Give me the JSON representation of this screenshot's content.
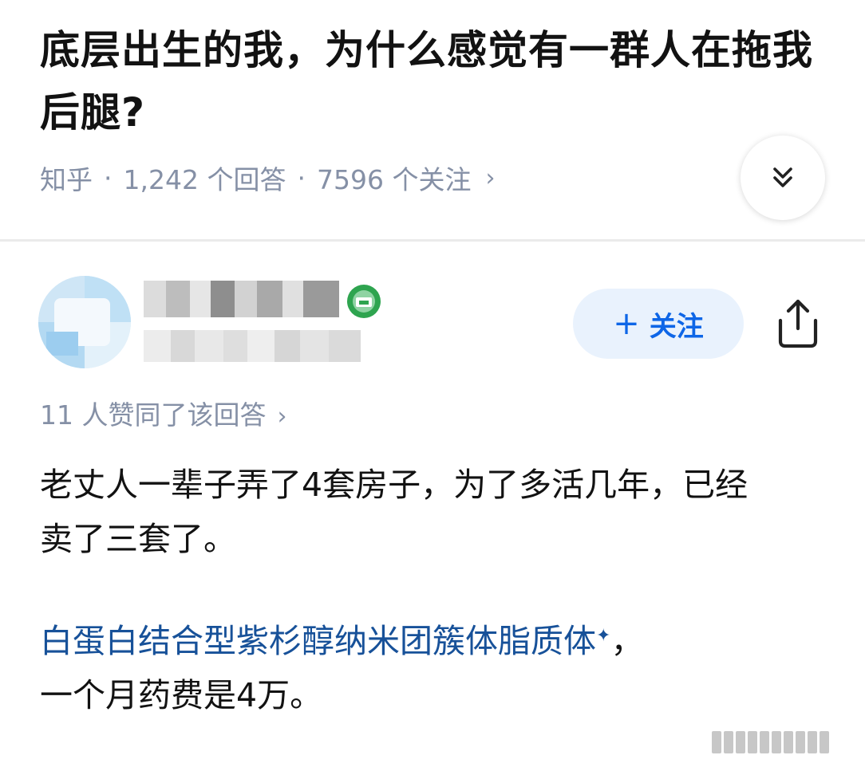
{
  "question": {
    "title": "底层出生的我，为什么感觉有一群人在拖我后腿?",
    "source": "知乎",
    "answers_count": "1,242 个回答",
    "followers_count": "7596 个关注"
  },
  "author": {
    "follow_label": "关注",
    "follow_plus": "+"
  },
  "answer": {
    "likes": "11 人赞同了该回答",
    "paragraph1": "老丈人一辈子弄了4套房子，为了多活几年，已经卖了三套了。",
    "drug_link": "白蛋白结合型紫杉醇纳米团簇体脂质体",
    "paragraph2_suffix": "，",
    "paragraph2_line2": "一个月药费是4万。"
  },
  "icons": {
    "expand": "double-chevron-down-icon",
    "share": "share-icon",
    "badge": "certified-badge-icon",
    "meta_chevron": "chevron-right-icon"
  },
  "colors": {
    "link": "#175199",
    "follow_text": "#0e66e7",
    "follow_bg": "#e9f2fd",
    "meta_gray": "#8590a6",
    "badge_green": "#2ea44f"
  }
}
